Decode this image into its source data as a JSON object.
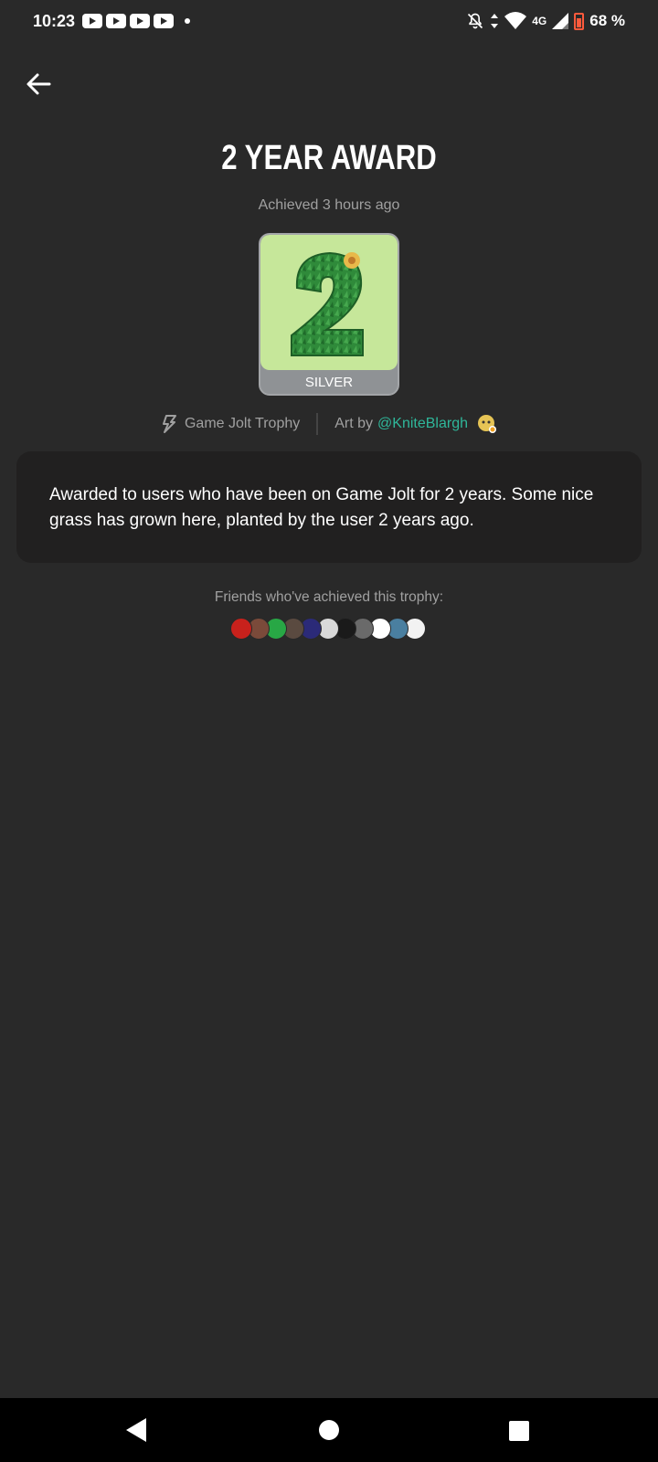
{
  "status_bar": {
    "time": "10:23",
    "network": "4G",
    "battery": "68 %",
    "notification_icons": [
      "youtube-icon",
      "youtube-icon",
      "youtube-icon",
      "youtube-icon"
    ]
  },
  "trophy": {
    "title": "2 YEAR AWARD",
    "achieved": "Achieved 3 hours ago",
    "tier": "SILVER",
    "tier_color": "#8f9295",
    "source": "Game Jolt Trophy",
    "art_by_prefix": "Art by",
    "artist": "@KniteBlargh",
    "description": "Awarded to users who have been on Game Jolt for 2 years. Some nice grass has grown here, planted by the user 2 years ago."
  },
  "friends": {
    "label": "Friends who've achieved this trophy:",
    "avatars": [
      "#c8211c",
      "#7a4a3a",
      "#28a745",
      "#5a4a40",
      "#2b2a78",
      "#d9d9d9",
      "#1a1a1a",
      "#6a6a6a",
      "#ffffff",
      "#4a7fa0",
      "#f2f2f2"
    ]
  },
  "colors": {
    "background": "#292929",
    "card": "#212020",
    "accent": "#2fb79a",
    "muted_text": "#a0a0a0"
  }
}
